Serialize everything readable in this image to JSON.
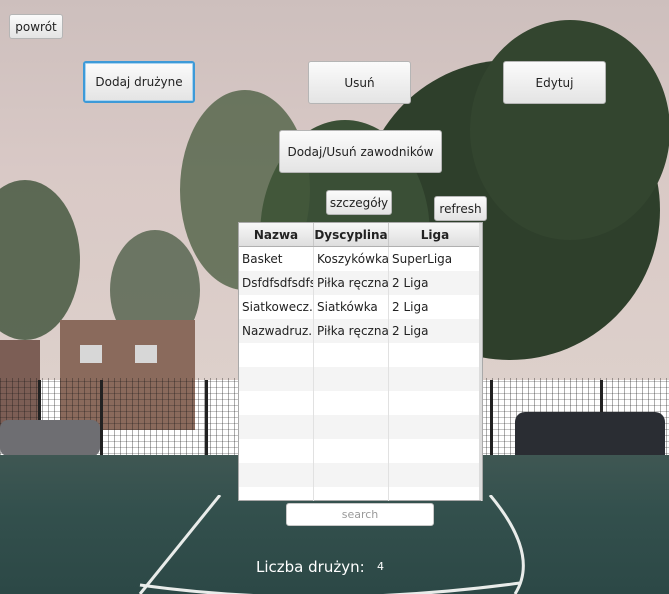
{
  "toolbar": {
    "back_label": "powrót",
    "add_team_label": "Dodaj drużyne",
    "delete_label": "Usuń",
    "edit_label": "Edytuj",
    "players_label": "Dodaj/Usuń zawodników",
    "details_label": "szczegóły",
    "refresh_label": "refresh"
  },
  "table": {
    "columns": [
      "Nazwa",
      "Dyscyplina",
      "Liga"
    ],
    "rows": [
      [
        "Basket",
        "Koszykówka",
        "SuperLiga"
      ],
      [
        "Dsfdfsdfsdfs",
        "Piłka ręczna",
        "2 Liga"
      ],
      [
        "Siatkowecz...",
        "Siatkówka",
        "2 Liga"
      ],
      [
        "Nazwadruz...",
        "Piłka ręczna",
        "2 Liga"
      ]
    ]
  },
  "search": {
    "placeholder": "search",
    "value": ""
  },
  "footer": {
    "count_label": "Liczba drużyn:",
    "count_value": "4"
  },
  "colors": {
    "focus_accent": "#3d9ad8"
  }
}
